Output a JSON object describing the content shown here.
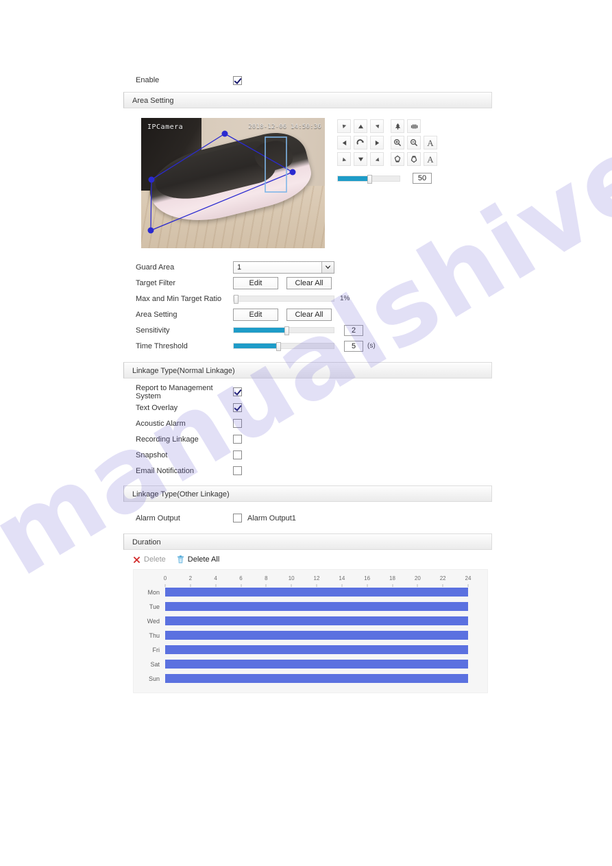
{
  "enable": {
    "label": "Enable",
    "checked": true
  },
  "sections": {
    "area_setting": "Area Setting",
    "linkage_normal": "Linkage Type(Normal Linkage)",
    "linkage_other": "Linkage Type(Other Linkage)",
    "duration": "Duration"
  },
  "preview": {
    "channel_name": "IPCamera",
    "timestamp": "2018-12-06 14:50:36"
  },
  "ptz": {
    "buttons": [
      {
        "name": "pan-up-left",
        "icon": "arrow-up-left-icon"
      },
      {
        "name": "pan-up",
        "icon": "arrow-up-icon"
      },
      {
        "name": "pan-up-right",
        "icon": "arrow-up-right-icon"
      },
      {
        "name": "pan-left",
        "icon": "arrow-left-icon"
      },
      {
        "name": "auto-scan",
        "icon": "rotate-icon"
      },
      {
        "name": "pan-right",
        "icon": "arrow-right-icon"
      },
      {
        "name": "pan-down-left",
        "icon": "arrow-down-left-icon"
      },
      {
        "name": "pan-down",
        "icon": "arrow-down-icon"
      },
      {
        "name": "pan-down-right",
        "icon": "arrow-down-right-icon"
      }
    ],
    "lens": [
      {
        "name": "iris-open",
        "icon": "tree-icon"
      },
      {
        "name": "iris-close",
        "icon": "iris-icon"
      },
      {
        "name": "zoom-in",
        "icon": "zoom-in-icon"
      },
      {
        "name": "zoom-out",
        "icon": "zoom-out-icon"
      },
      {
        "name": "zoom-auto",
        "label": "A"
      },
      {
        "name": "focus-near",
        "icon": "focus-near-icon"
      },
      {
        "name": "focus-far",
        "icon": "focus-far-icon"
      },
      {
        "name": "focus-auto",
        "label": "A"
      }
    ],
    "speed": {
      "value": "50",
      "percent": 50
    }
  },
  "settings": {
    "guard_area": {
      "label": "Guard Area",
      "value": "1"
    },
    "target_filter": {
      "label": "Target Filter",
      "edit": "Edit",
      "clear_all": "Clear All"
    },
    "target_ratio": {
      "label": "Max and Min Target Ratio",
      "value": "1%",
      "percent": 1
    },
    "area_setting": {
      "label": "Area Setting",
      "edit": "Edit",
      "clear_all": "Clear All"
    },
    "sensitivity": {
      "label": "Sensitivity",
      "value": "2",
      "percent": 52
    },
    "time_threshold": {
      "label": "Time Threshold",
      "value": "5",
      "unit": "(s)",
      "percent": 44
    }
  },
  "linkage_normal": [
    {
      "label": "Report to Management System",
      "checked": true
    },
    {
      "label": "Text Overlay",
      "checked": true
    },
    {
      "label": "Acoustic Alarm",
      "checked": false
    },
    {
      "label": "Recording Linkage",
      "checked": false
    },
    {
      "label": "Snapshot",
      "checked": false
    },
    {
      "label": "Email Notification",
      "checked": false
    }
  ],
  "linkage_other": {
    "label": "Alarm Output",
    "option_label": "Alarm Output1",
    "checked": false
  },
  "duration": {
    "delete_label": "Delete",
    "delete_all_label": "Delete All",
    "ticks": [
      "0",
      "2",
      "4",
      "6",
      "8",
      "10",
      "12",
      "14",
      "16",
      "18",
      "20",
      "22",
      "24"
    ],
    "days": [
      {
        "label": "Mon",
        "start": 0,
        "end": 24
      },
      {
        "label": "Tue",
        "start": 0,
        "end": 24
      },
      {
        "label": "Wed",
        "start": 0,
        "end": 24
      },
      {
        "label": "Thu",
        "start": 0,
        "end": 24
      },
      {
        "label": "Fri",
        "start": 0,
        "end": 24
      },
      {
        "label": "Sat",
        "start": 0,
        "end": 24
      },
      {
        "label": "Sun",
        "start": 0,
        "end": 24
      }
    ]
  },
  "watermark": {
    "text": "manualshive.com"
  },
  "colors": {
    "slider_fill": "#1e9cc8",
    "schedule_bar": "#5b71e0",
    "delete_icon": "#d32f2f",
    "delete_all_icon": "#4fa8d8",
    "region_line": "#2a2ad0"
  }
}
